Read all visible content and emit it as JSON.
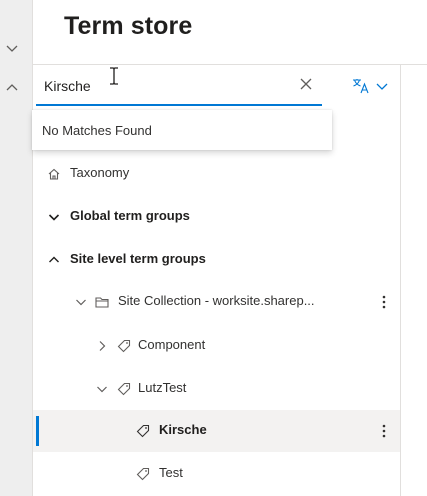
{
  "header": {
    "title": "Term store"
  },
  "search": {
    "value": "Kirsche",
    "clear_icon": "close-icon",
    "language_icon": "translate-icon"
  },
  "dropdown": {
    "message": "No Matches Found"
  },
  "tree": {
    "taxonomy": "Taxonomy",
    "global_groups": "Global term groups",
    "site_groups": "Site level term groups",
    "site_collection": "Site Collection - worksite.sharep...",
    "component": "Component",
    "lutztest": "LutzTest",
    "kirsche": "Kirsche",
    "test": "Test"
  },
  "colors": {
    "accent": "#0078d4",
    "selected_bg": "#f3f2f1",
    "rail_bg": "#eeeeee"
  }
}
